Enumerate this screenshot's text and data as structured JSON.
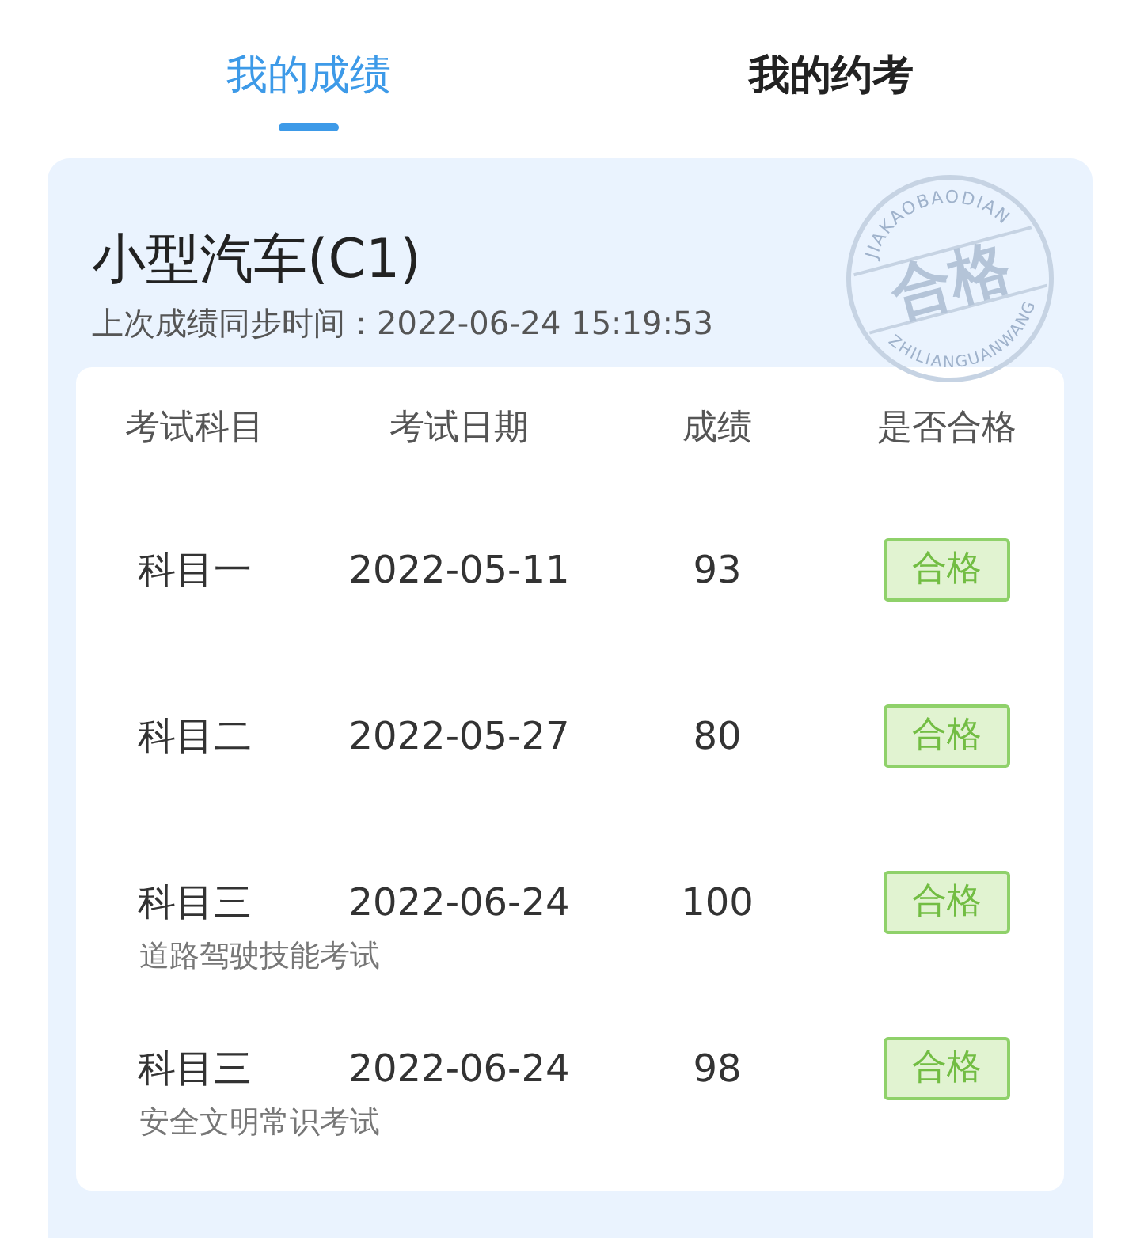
{
  "tabs": [
    {
      "label": "我的成绩",
      "selected": true
    },
    {
      "label": "我的约考",
      "selected": false
    }
  ],
  "card": {
    "title": "小型汽车(C1)",
    "sync_time": "上次成绩同步时间：2022-06-24 15:19:53",
    "stamp": {
      "top_text": "JIAKAOBAODIAN",
      "center_text": "合格",
      "bottom_text": "ZHILIANGUANWANG"
    }
  },
  "table": {
    "columns": [
      "考试科目",
      "考试日期",
      "成绩",
      "是否合格"
    ],
    "rows": [
      {
        "subject": "科目一",
        "date": "2022-05-11",
        "score": "93",
        "result": "合格",
        "passed": true
      },
      {
        "subject": "科目二",
        "date": "2022-05-27",
        "score": "80",
        "result": "合格",
        "passed": true
      },
      {
        "subject": "科目三",
        "date": "2022-06-24",
        "score": "100",
        "result": "合格",
        "passed": true,
        "note": "道路驾驶技能考试"
      },
      {
        "subject": "科目三",
        "date": "2022-06-24",
        "score": "98",
        "result": "合格",
        "passed": true,
        "note": "安全文明常识考试"
      }
    ]
  }
}
